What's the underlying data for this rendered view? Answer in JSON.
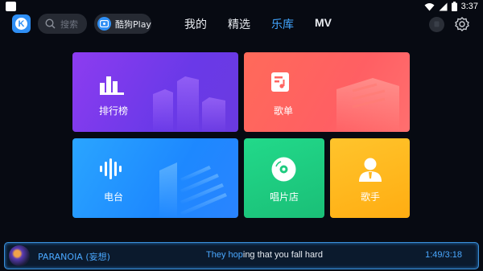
{
  "status_bar": {
    "time": "3:37",
    "icons": [
      "notification-square-icon",
      "wifi-icon",
      "signal-icon",
      "battery-icon"
    ]
  },
  "topnav": {
    "logo": "K",
    "search_placeholder": "搜索",
    "kugou_play_label": "酷狗Play",
    "tabs": [
      {
        "label": "我的",
        "active": false
      },
      {
        "label": "精选",
        "active": false
      },
      {
        "label": "乐库",
        "active": true
      },
      {
        "label": "MV",
        "active": false
      }
    ],
    "accent_color": "#42a5ff"
  },
  "tiles": {
    "rank": {
      "label": "排行榜",
      "color": "#7a3aee"
    },
    "playlist": {
      "label": "歌单",
      "color": "#ff6461"
    },
    "radio": {
      "label": "电台",
      "color": "#1e8cff"
    },
    "store": {
      "label": "唱片店",
      "color": "#1ecb7f"
    },
    "singer": {
      "label": "歌手",
      "color": "#ffb81e"
    }
  },
  "player": {
    "song": "PARANOIA (妄想)",
    "lyric_highlight": "They hop",
    "lyric_rest": "ing that you fall hard",
    "time": "1:49/3:18"
  }
}
